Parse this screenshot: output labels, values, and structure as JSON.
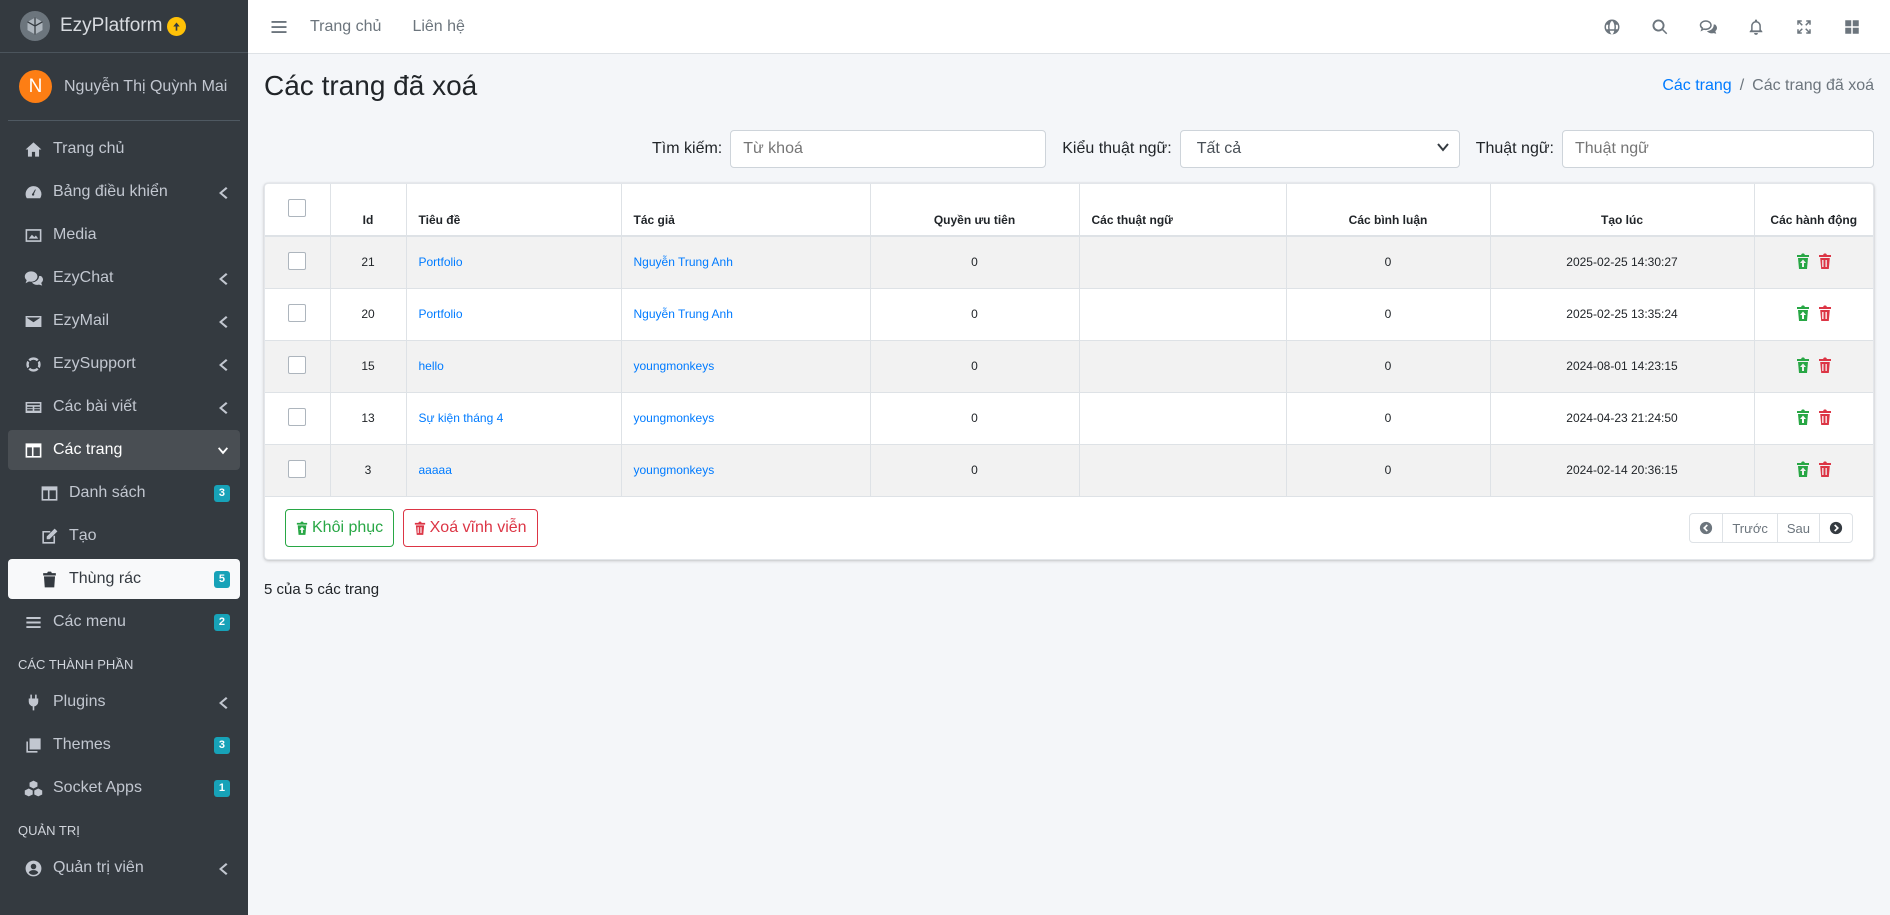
{
  "brand": {
    "name": "EzyPlatform"
  },
  "user": {
    "initial": "N",
    "name": "Nguyễn Thị Quỳnh Mai"
  },
  "sidebar": {
    "items": [
      {
        "label": "Trang chủ",
        "icon": "home-icon"
      },
      {
        "label": "Bảng điều khiển",
        "icon": "dashboard-icon"
      },
      {
        "label": "Media",
        "icon": "image-icon"
      },
      {
        "label": "EzyChat",
        "icon": "chat-icon"
      },
      {
        "label": "EzyMail",
        "icon": "mail-icon"
      },
      {
        "label": "EzySupport",
        "icon": "support-icon"
      },
      {
        "label": "Các bài viết",
        "icon": "newspaper-icon"
      },
      {
        "label": "Các trang",
        "icon": "pages-icon"
      }
    ],
    "sub_items": [
      {
        "label": "Danh sách",
        "badge": "3"
      },
      {
        "label": "Tạo",
        "badge": ""
      },
      {
        "label": "Thùng rác",
        "badge": "5"
      }
    ],
    "menus": {
      "label": "Các menu",
      "badge": "2"
    },
    "header_components": "CÁC THÀNH PHẦN",
    "plugins": {
      "label": "Plugins"
    },
    "themes": {
      "label": "Themes",
      "badge": "3"
    },
    "socket_apps": {
      "label": "Socket Apps",
      "badge": "1"
    },
    "header_admin": "QUẢN TRỊ",
    "admins": {
      "label": "Quản trị viên"
    }
  },
  "topbar": {
    "home": "Trang chủ",
    "contact": "Liên hệ"
  },
  "page": {
    "title": "Các trang đã xoá",
    "breadcrumb": {
      "parent": "Các trang",
      "current": "Các trang đã xoá"
    }
  },
  "filters": {
    "search_label": "Tìm kiếm:",
    "search_placeholder": "Từ khoá",
    "term_type_label": "Kiểu thuật ngữ:",
    "term_type_value": "Tất cả",
    "term_label": "Thuật ngữ:",
    "term_placeholder": "Thuật ngữ"
  },
  "table": {
    "headers": [
      "Id",
      "Tiêu đề",
      "Tác giả",
      "Quyền ưu tiên",
      "Các thuật ngữ",
      "Các bình luận",
      "Tạo lúc",
      "Các hành động"
    ],
    "rows": [
      {
        "id": "21",
        "title": "Portfolio",
        "author": "Nguyễn Trung Anh",
        "priority": "0",
        "terms": "",
        "comments": "0",
        "created": "2025-02-25 14:30:27"
      },
      {
        "id": "20",
        "title": "Portfolio",
        "author": "Nguyễn Trung Anh",
        "priority": "0",
        "terms": "",
        "comments": "0",
        "created": "2025-02-25 13:35:24"
      },
      {
        "id": "15",
        "title": "hello",
        "author": "youngmonkeys",
        "priority": "0",
        "terms": "",
        "comments": "0",
        "created": "2024-08-01 14:23:15"
      },
      {
        "id": "13",
        "title": "Sự kiện tháng 4",
        "author": "youngmonkeys",
        "priority": "0",
        "terms": "",
        "comments": "0",
        "created": "2024-04-23 21:24:50"
      },
      {
        "id": "3",
        "title": "aaaaa",
        "author": "youngmonkeys",
        "priority": "0",
        "terms": "",
        "comments": "0",
        "created": "2024-02-14 20:36:15"
      }
    ]
  },
  "actions": {
    "restore": "Khôi phục",
    "delete_forever": "Xoá vĩnh viễn"
  },
  "pager": {
    "prev": "Trước",
    "next": "Sau"
  },
  "summary": "5 của 5 các trang",
  "colors": {
    "sidebar": "#343a40",
    "link": "#007bff",
    "success": "#28a745",
    "danger": "#dc3545",
    "badge": "#17a2b8"
  }
}
